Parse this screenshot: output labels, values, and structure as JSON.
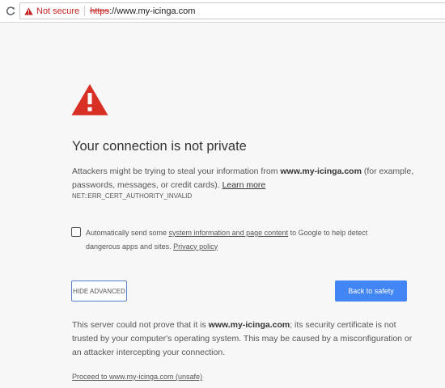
{
  "browser": {
    "security_label": "Not secure",
    "url_scheme": "https",
    "url_rest": "://www.my-icinga.com",
    "icons": {
      "reload": "reload-icon",
      "warning_small": "warning-triangle-icon"
    },
    "colors": {
      "insecure_red": "#c5221f"
    }
  },
  "interstitial": {
    "icon": "warning-triangle-icon",
    "icon_color": "#d93025",
    "heading": "Your connection is not private",
    "intro": {
      "text_before": "Attackers might be trying to steal your information from ",
      "domain": "www.my-icinga.com",
      "text_after": " (for example, passwords, messages, or credit cards). ",
      "learn_more": "Learn more"
    },
    "error_code": "NET::ERR_CERT_AUTHORITY_INVALID",
    "opt_in": {
      "checked": false,
      "text_before": "Automatically send some ",
      "link1": "system information and page content",
      "text_middle": " to Google to help detect dangerous apps and sites. ",
      "link2": "Privacy policy"
    },
    "buttons": {
      "hide_advanced": "HIDE ADVANCED",
      "back_to_safety": "Back to safety",
      "primary_color": "#4285f4"
    },
    "details": {
      "text_before": "This server could not prove that it is ",
      "domain": "www.my-icinga.com",
      "text_after": "; its security certificate is not trusted by your computer's operating system. This may be caused by a misconfiguration or an attacker intercepting your connection."
    },
    "proceed_link": "Proceed to www.my-icinga.com (unsafe)"
  }
}
